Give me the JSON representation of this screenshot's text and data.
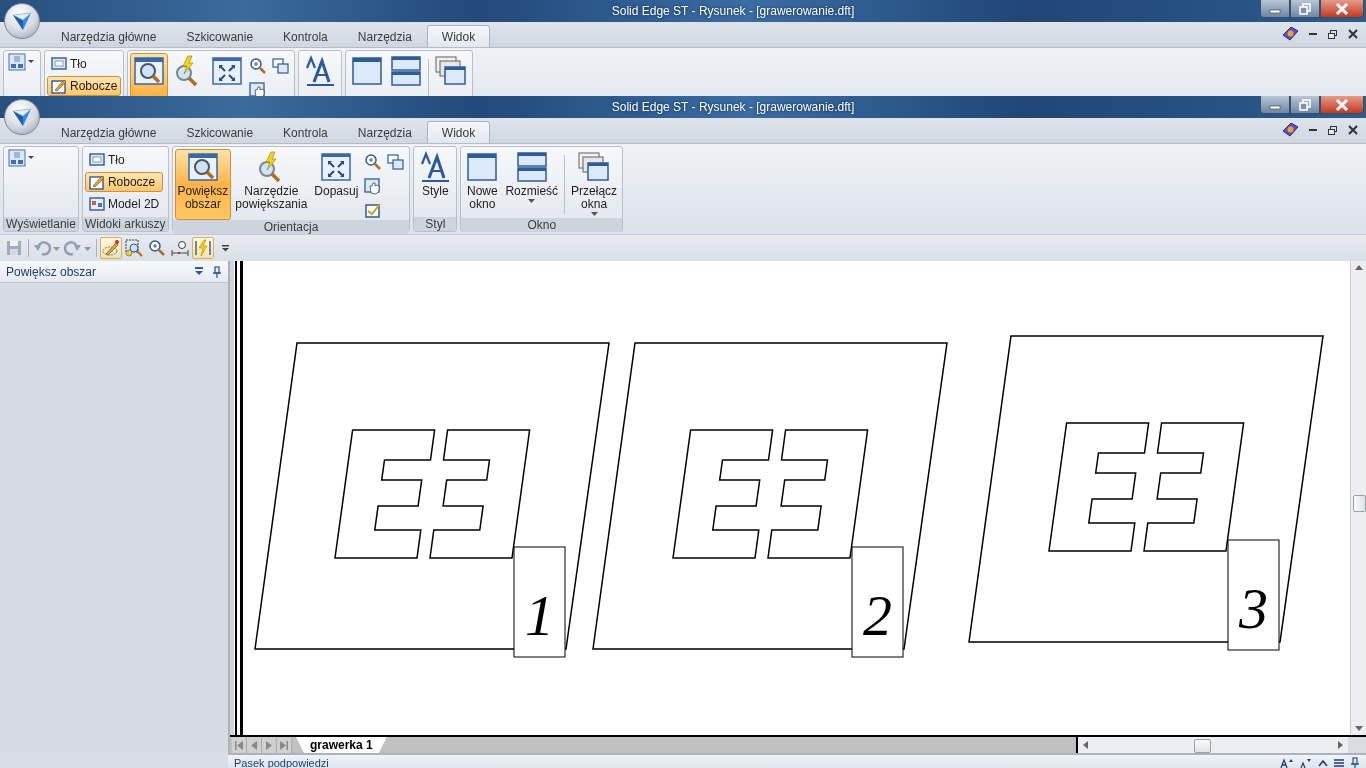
{
  "ghost_window": {
    "title": "Solid Edge ST - Rysunek - [grawerowanie.dft]",
    "tabs": [
      {
        "label": "Narzędzia główne",
        "selected": false
      },
      {
        "label": "Szkicowanie",
        "selected": false
      },
      {
        "label": "Kontrola",
        "selected": false
      },
      {
        "label": "Narzędzia",
        "selected": false
      },
      {
        "label": "Widok",
        "selected": true
      }
    ],
    "ribbon_groups": [
      {
        "items": [
          {
            "kind": "menu"
          }
        ]
      },
      {
        "items": [
          {
            "kind": "small",
            "label": "Tło",
            "selected": false
          },
          {
            "kind": "small",
            "label": "Robocze",
            "selected": true
          }
        ]
      },
      {
        "items": [
          {
            "kind": "large",
            "selected": true
          },
          {
            "kind": "large",
            "selected": false
          },
          {
            "kind": "large",
            "selected": false
          },
          {
            "kind": "icons"
          }
        ]
      },
      {
        "items": [
          {
            "kind": "large",
            "selected": false
          }
        ]
      },
      {
        "items": [
          {
            "kind": "large",
            "selected": false
          },
          {
            "kind": "large",
            "selected": false
          },
          {
            "kind": "large",
            "selected": false
          }
        ]
      }
    ]
  },
  "window": {
    "title": "Solid Edge ST - Rysunek - [grawerowanie.dft]"
  },
  "tabs": [
    {
      "label": "Narzędzia główne",
      "selected": false
    },
    {
      "label": "Szkicowanie",
      "selected": false
    },
    {
      "label": "Kontrola",
      "selected": false
    },
    {
      "label": "Narzędzia",
      "selected": false
    },
    {
      "label": "Widok",
      "selected": true
    }
  ],
  "ribbon_groups": [
    {
      "label": "Wyświetlanie",
      "items": [
        {
          "kind": "menu"
        }
      ]
    },
    {
      "label": "Widoki arkuszy",
      "items": [
        {
          "kind": "small",
          "label": "Tło",
          "selected": false
        },
        {
          "kind": "small",
          "label": "Robocze",
          "selected": true
        },
        {
          "kind": "small",
          "label": "Model 2D",
          "selected": false
        }
      ]
    },
    {
      "label": "Orientacja",
      "items": [
        {
          "kind": "large",
          "label": "Powiększ\nobszar",
          "selected": true
        },
        {
          "kind": "large",
          "label": "Narzędzie\npowiększania",
          "selected": false
        },
        {
          "kind": "large",
          "label": "Dopasuj",
          "selected": false
        },
        {
          "kind": "icons"
        }
      ]
    },
    {
      "label": "Styl",
      "items": [
        {
          "kind": "large",
          "label": "Style",
          "selected": false
        }
      ]
    },
    {
      "label": "Okno",
      "items": [
        {
          "kind": "large",
          "label": "Nowe\nokno",
          "selected": false
        },
        {
          "kind": "large",
          "label": "Rozmieść",
          "selected": false,
          "dropdown": true
        },
        {
          "kind": "large",
          "label": "Przełącz\nokna",
          "selected": false,
          "dropdown": true
        }
      ]
    }
  ],
  "quick_access": [
    {
      "kind": "button",
      "disabled": true
    },
    {
      "kind": "split",
      "disabled": true
    },
    {
      "kind": "split",
      "disabled": true
    },
    {
      "kind": "button",
      "pressed": true
    },
    {
      "kind": "button",
      "pressed": false
    },
    {
      "kind": "button",
      "pressed": false
    },
    {
      "kind": "button",
      "pressed": false
    },
    {
      "kind": "button",
      "pressed": true
    },
    {
      "kind": "menu"
    }
  ],
  "side_panel": {
    "title": "Powiększ obszar"
  },
  "drawings": [
    {
      "label": "1"
    },
    {
      "label": "2"
    },
    {
      "label": "3"
    }
  ],
  "sheet_tabs": [
    {
      "label": "grawerka 1",
      "selected": true
    }
  ],
  "status_bar": {
    "text": "Pasek podpowiedzi"
  }
}
